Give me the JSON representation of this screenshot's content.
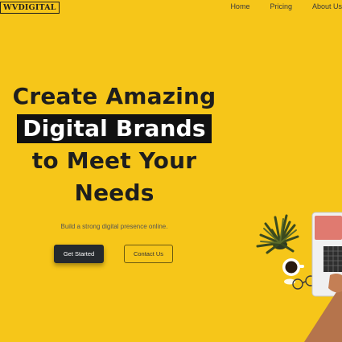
{
  "brand": {
    "logo_text": "WVDIGITAL"
  },
  "nav": {
    "items": [
      {
        "label": "Home"
      },
      {
        "label": "Pricing"
      },
      {
        "label": "About Us"
      }
    ]
  },
  "hero": {
    "headline_line1": "Create Amazing",
    "headline_highlight": "Digital Brands",
    "headline_line3": "to Meet Your",
    "headline_line4": "Needs",
    "subtitle": "Build a strong digital presence online.",
    "primary_button": "Get Started",
    "secondary_button": "Contact Us"
  },
  "colors": {
    "background": "#f6c619",
    "text": "#1e1e1e",
    "highlight_bg": "#111111",
    "button_dark": "#262a2e"
  },
  "illustration": {
    "icons": [
      "plant-icon",
      "coffee-cup-icon",
      "glasses-icon",
      "laptop-icon",
      "hand-icon"
    ]
  }
}
